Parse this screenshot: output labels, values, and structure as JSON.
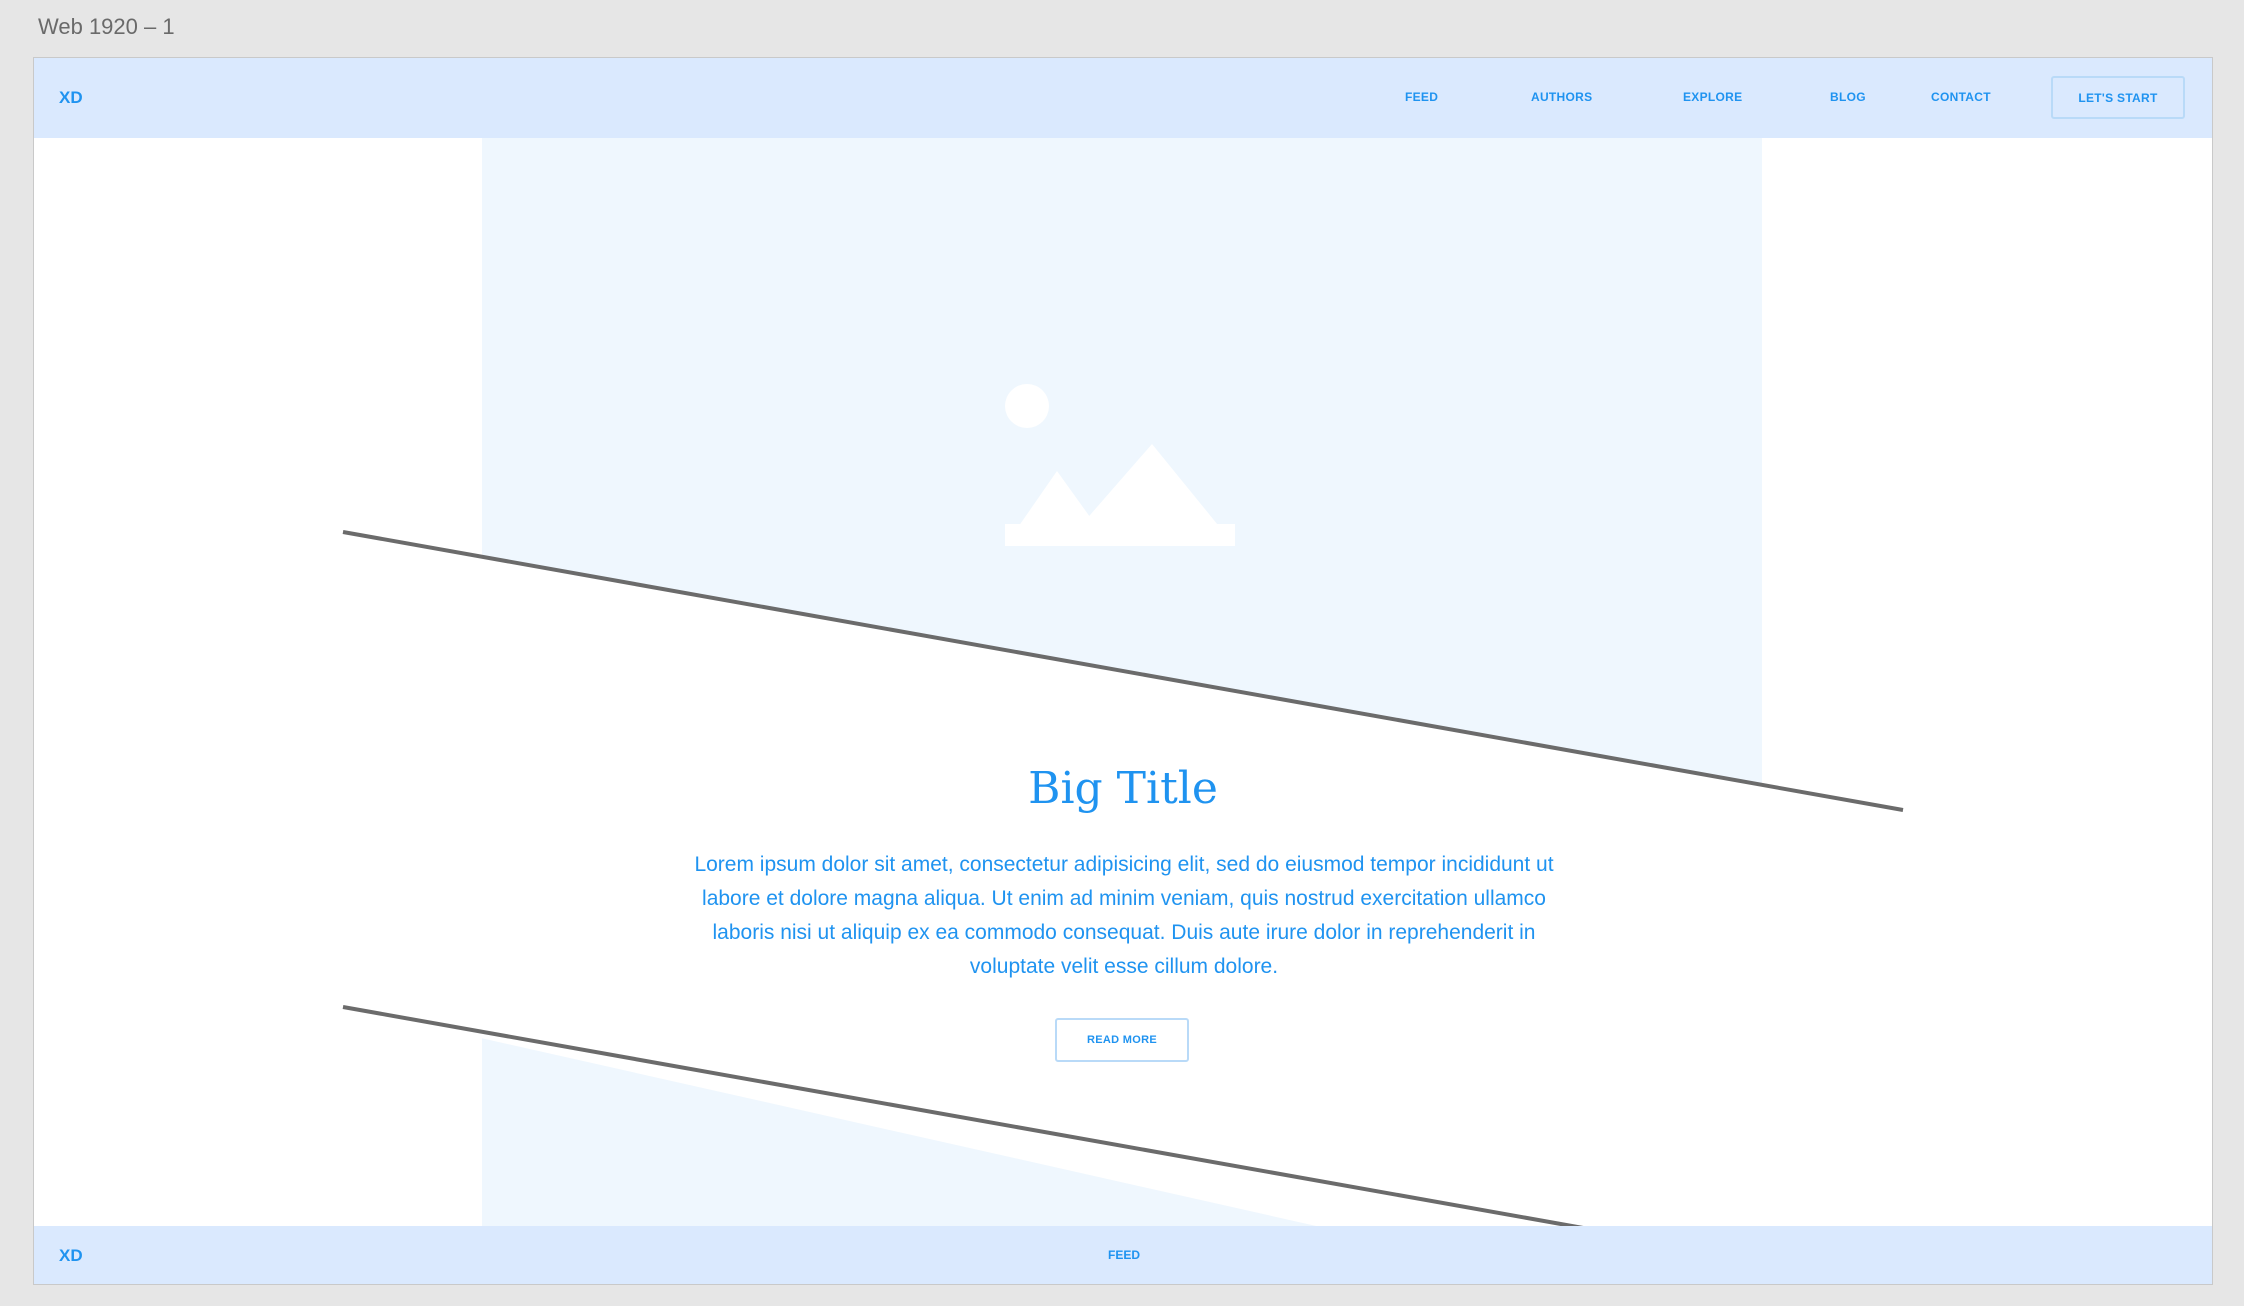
{
  "artboard": {
    "title": "Web 1920 – 1"
  },
  "header": {
    "logo": "XD",
    "nav": [
      {
        "label": "FEED"
      },
      {
        "label": "AUTHORS"
      },
      {
        "label": "EXPLORE"
      },
      {
        "label": "BLOG"
      },
      {
        "label": "CONTACT"
      }
    ],
    "cta_label": "LET'S START"
  },
  "hero": {
    "image_icon": "image-placeholder-icon",
    "title": "Big Title",
    "body": "Lorem ipsum dolor sit amet, consectetur adipisicing elit, sed do eiusmod tempor incididunt ut labore et dolore magna aliqua. Ut enim ad minim veniam, quis nostrud exercitation ullamco laboris nisi ut aliquip ex ea commodo consequat. Duis aute irure dolor in reprehenderit in voluptate velit esse cillum dolore.",
    "button_label": "READ MORE"
  },
  "footer": {
    "logo": "XD",
    "link": "FEED"
  },
  "colors": {
    "accent": "#1f93f0",
    "bar_background": "#dae9fe",
    "image_background": "#eff7fe",
    "line": "#6b6b6b"
  }
}
